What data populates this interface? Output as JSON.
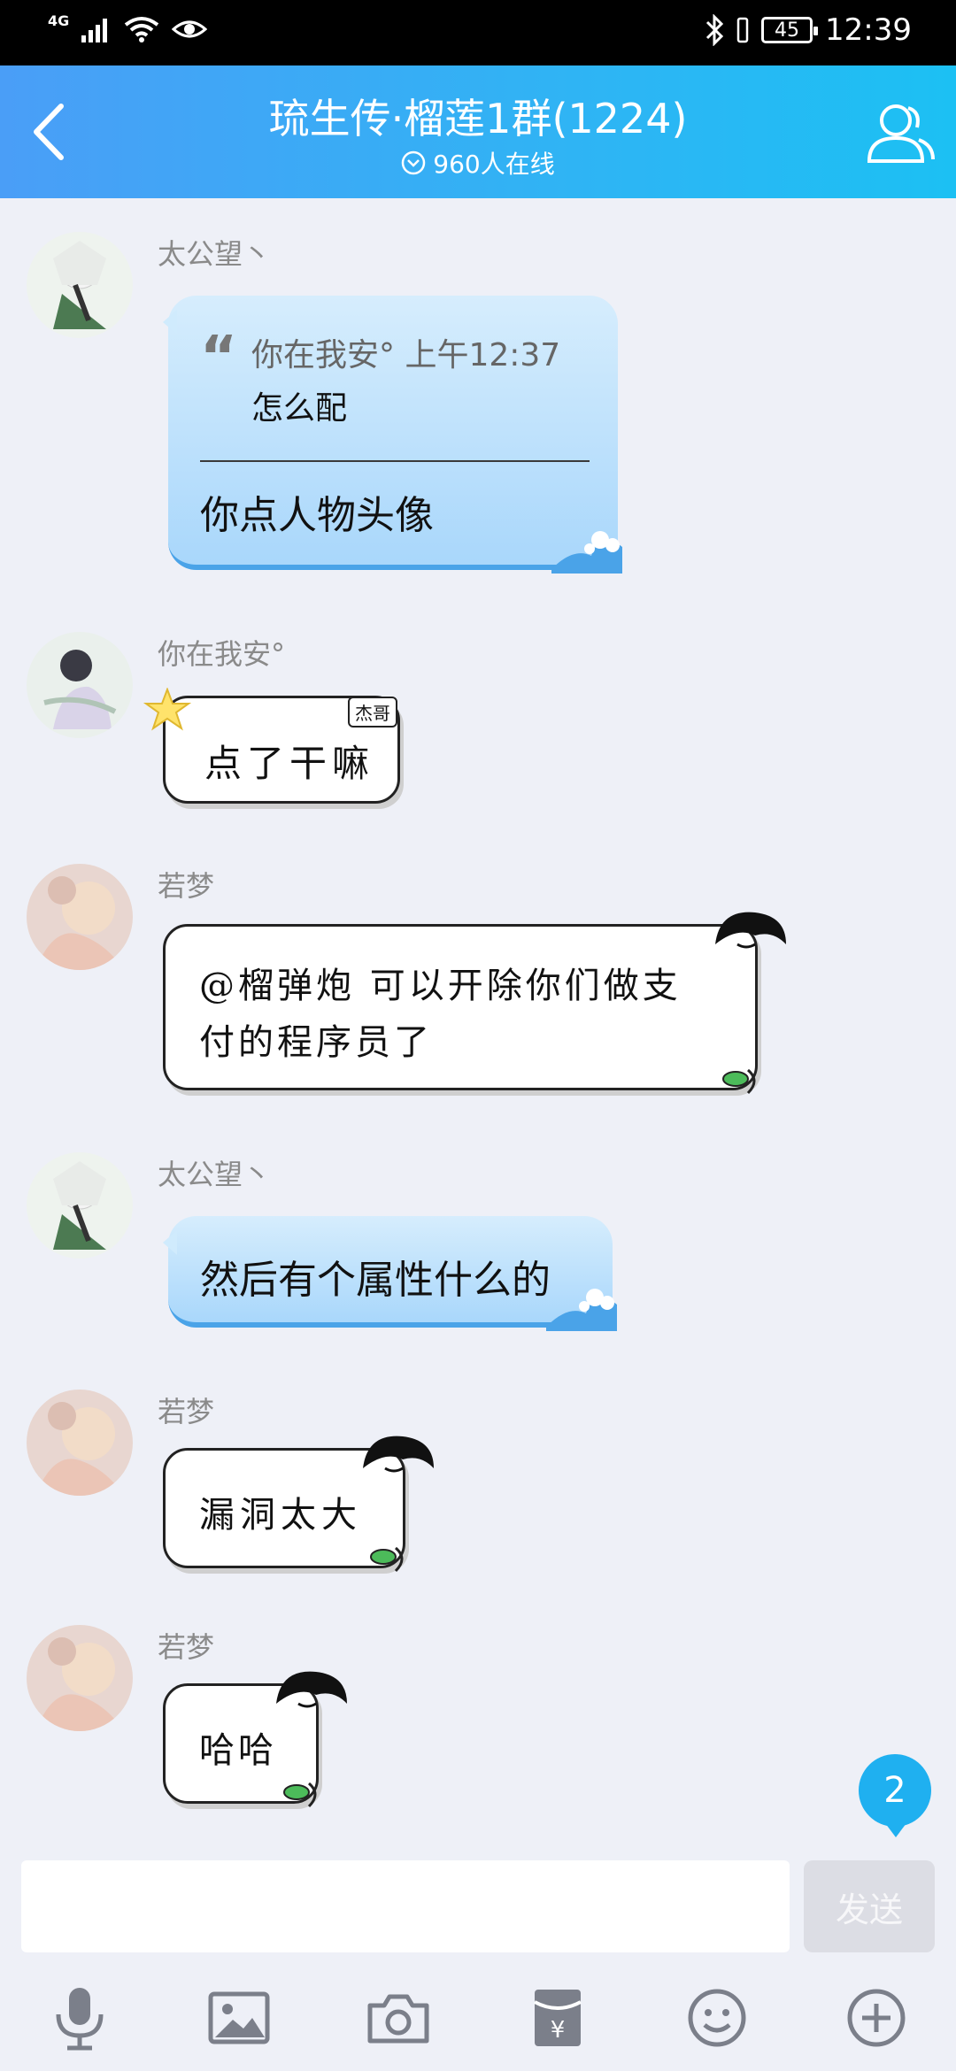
{
  "status_bar": {
    "network": "4G",
    "battery": "45",
    "time": "12:39"
  },
  "header": {
    "title": "琉生传·榴莲1群(1224)",
    "online": "960人在线"
  },
  "messages": [
    {
      "sender": "太公望丶",
      "quote_author": "你在我安°",
      "quote_time": "上午12:37",
      "quote_text": "怎么配",
      "text": "你点人物头像"
    },
    {
      "sender": "你在我安°",
      "badge": "杰哥",
      "text": "点了干嘛"
    },
    {
      "sender": "若梦",
      "text_line1": "@榴弹炮 可以开除你们做支",
      "text_line2": "付的程序员了"
    },
    {
      "sender": "太公望丶",
      "text": "然后有个属性什么的"
    },
    {
      "sender": "若梦",
      "text": "漏洞太大"
    },
    {
      "sender": "若梦",
      "text": "哈哈"
    }
  ],
  "unread_count": "2",
  "input": {
    "placeholder": "",
    "send_label": "发送"
  },
  "toolbar_icons": [
    "microphone-icon",
    "image-icon",
    "camera-icon",
    "red-packet-icon",
    "emoji-icon",
    "plus-icon"
  ],
  "colors": {
    "header_start": "#4a9ef7",
    "header_end": "#1cc0f3",
    "blue_bubble": "#a9d7fb",
    "unread": "#1fb0f0"
  }
}
